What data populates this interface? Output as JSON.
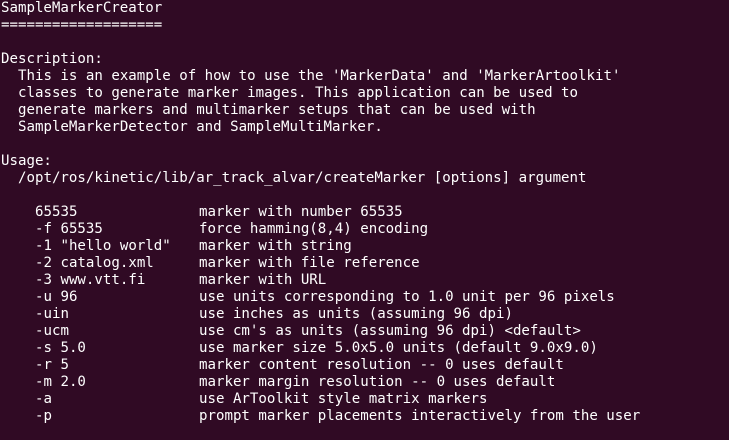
{
  "title": "SampleMarkerCreator",
  "underline": "===================",
  "description": {
    "heading": "Description:",
    "lines": [
      "This is an example of how to use the 'MarkerData' and 'MarkerArtoolkit'",
      "classes to generate marker images. This application can be used to",
      "generate markers and multimarker setups that can be used with",
      "SampleMarkerDetector and SampleMultiMarker."
    ]
  },
  "usage": {
    "heading": "Usage:",
    "command": "/opt/ros/kinetic/lib/ar_track_alvar/createMarker [options] argument"
  },
  "options": [
    {
      "flag": "65535",
      "desc": "marker with number 65535"
    },
    {
      "flag": "-f 65535",
      "desc": "force hamming(8,4) encoding"
    },
    {
      "flag": "-1 \"hello world\"",
      "desc": "marker with string"
    },
    {
      "flag": "-2 catalog.xml",
      "desc": "marker with file reference"
    },
    {
      "flag": "-3 www.vtt.fi",
      "desc": "marker with URL"
    },
    {
      "flag": "-u 96",
      "desc": "use units corresponding to 1.0 unit per 96 pixels"
    },
    {
      "flag": "-uin",
      "desc": "use inches as units (assuming 96 dpi)"
    },
    {
      "flag": "-ucm",
      "desc": "use cm's as units (assuming 96 dpi) <default>"
    },
    {
      "flag": "-s 5.0",
      "desc": "use marker size 5.0x5.0 units (default 9.0x9.0)"
    },
    {
      "flag": "-r 5",
      "desc": "marker content resolution -- 0 uses default"
    },
    {
      "flag": "-m 2.0",
      "desc": "marker margin resolution -- 0 uses default"
    },
    {
      "flag": "-a",
      "desc": "use ArToolkit style matrix markers"
    },
    {
      "flag": "-p",
      "desc": "prompt marker placements interactively from the user"
    }
  ],
  "colors": {
    "background": "#300a24",
    "text": "#ffffff"
  }
}
